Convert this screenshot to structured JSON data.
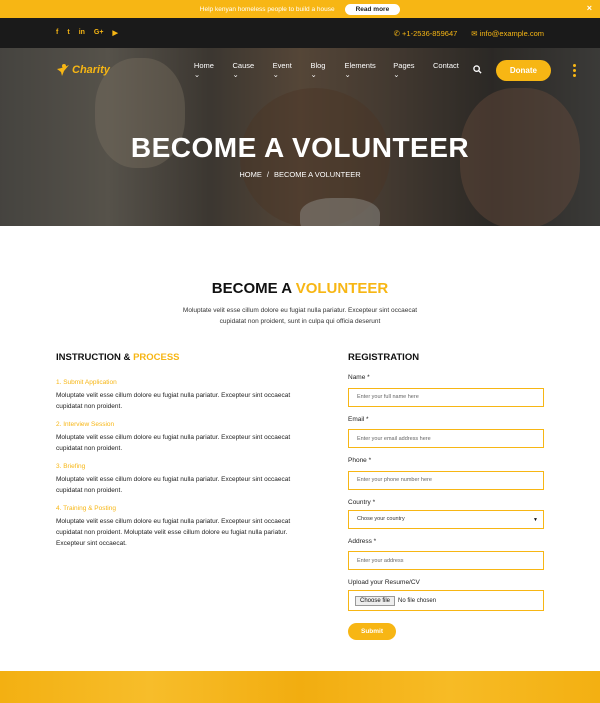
{
  "topbar": {
    "message": "Help kenyan homeless people to build a house",
    "button": "Read more",
    "close": "×"
  },
  "social": [
    "f",
    "t",
    "in",
    "G+",
    "▶"
  ],
  "contact": {
    "phone": "+1-2536-859647",
    "email": "info@example.com"
  },
  "brand": {
    "name": "Charity"
  },
  "nav": {
    "items": [
      "Home",
      "Cause",
      "Event",
      "Blog",
      "Elements",
      "Pages",
      "Contact"
    ],
    "donate": "Donate"
  },
  "hero": {
    "title": "BECOME A VOLUNTEER",
    "crumb_home": "HOME",
    "crumb_sep": "/",
    "crumb_current": "BECOME A VOLUNTEER"
  },
  "intro": {
    "title_plain": "BECOME A ",
    "title_accent": "VOLUNTEER",
    "text": "Moluptate velit esse cillum dolore eu fugiat nulla pariatur. Excepteur sint occaecat cupidatat non proident, sunt in culpa qui officia deserunt"
  },
  "instruction": {
    "title_plain": "INSTRUCTION & ",
    "title_accent": "PROCESS",
    "steps": [
      {
        "title": "1. Submit Application",
        "text": "Moluptate velit esse cillum dolore eu fugiat nulla pariatur. Excepteur sint occaecat cupidatat non proident."
      },
      {
        "title": "2. Interview Session",
        "text": "Moluptate velit esse cillum dolore eu fugiat nulla pariatur. Excepteur sint occaecat cupidatat non proident."
      },
      {
        "title": "3. Briefing",
        "text": "Moluptate velit esse cillum dolore eu fugiat nulla pariatur. Excepteur sint occaecat cupidatat non proident."
      },
      {
        "title": "4. Training & Posting",
        "text": "Moluptate velit esse cillum dolore eu fugiat nulla pariatur. Excepteur sint occaecat cupidatat non proident. Moluptate velit esse cillum dolore eu fugiat nulla pariatur. Excepteur sint occaecat."
      }
    ]
  },
  "registration": {
    "title": "REGISTRATION",
    "name_label": "Name *",
    "name_placeholder": "Enter your full name here",
    "email_label": "Email *",
    "email_placeholder": "Enter your email address here",
    "phone_label": "Phone *",
    "phone_placeholder": "Enter your phone number here",
    "country_label": "Country *",
    "country_value": "Chose your country",
    "address_label": "Address *",
    "address_placeholder": "Enter your address",
    "upload_label": "Upload your Resume/CV",
    "file_button": "Choose file",
    "file_status": "No file chosen",
    "submit": "Submit"
  },
  "colors": {
    "accent": "#f7b614",
    "dark": "#1a1a1a"
  }
}
